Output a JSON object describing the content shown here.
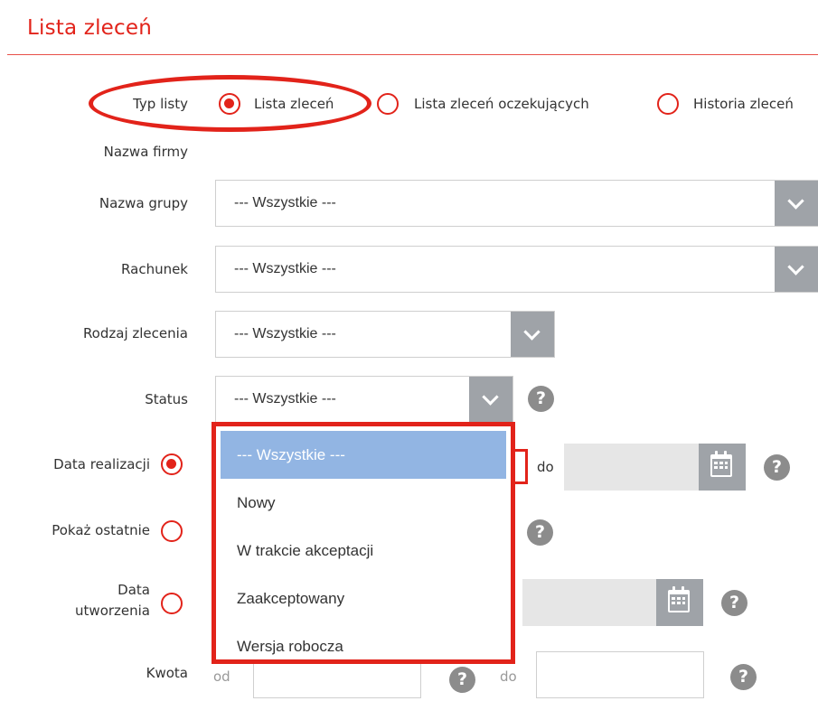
{
  "page": {
    "title": "Lista zleceń"
  },
  "list_type": {
    "label": "Typ listy",
    "options": [
      {
        "label": "Lista zleceń",
        "checked": true
      },
      {
        "label": "Lista zleceń oczekujących",
        "checked": false
      },
      {
        "label": "Historia zleceń",
        "checked": false
      }
    ]
  },
  "company": {
    "label": "Nazwa firmy"
  },
  "group": {
    "label": "Nazwa grupy",
    "value": "--- Wszystkie ---"
  },
  "account": {
    "label": "Rachunek",
    "value": "--- Wszystkie ---"
  },
  "order_type": {
    "label": "Rodzaj zlecenia",
    "value": "--- Wszystkie ---"
  },
  "status": {
    "label": "Status",
    "value": "--- Wszystkie ---",
    "help": "?",
    "options": [
      "--- Wszystkie ---",
      "Nowy",
      "W trakcie akceptacji",
      "Zaakceptowany",
      "Wersja robocza"
    ],
    "selected_index": 0,
    "dropdown_open": true
  },
  "execution_date": {
    "label": "Data realizacji",
    "checked": true,
    "to_label": "do",
    "help": "?"
  },
  "show_last": {
    "label": "Pokaż ostatnie",
    "checked": false,
    "help": "?"
  },
  "created_date": {
    "label_line1": "Data",
    "label_line2": "utworzenia",
    "checked": false,
    "help": "?"
  },
  "amount": {
    "label": "Kwota",
    "from_label": "od",
    "to_label": "do",
    "help": "?"
  },
  "icons": {
    "select_arrow": "chevron-down-icon",
    "calendar": "calendar-icon",
    "help": "question-icon"
  },
  "colors": {
    "accent": "#e2231a",
    "button_grey": "#9fa3a8",
    "help_grey": "#8c8c8c",
    "selected_option": "#92b5e3"
  }
}
